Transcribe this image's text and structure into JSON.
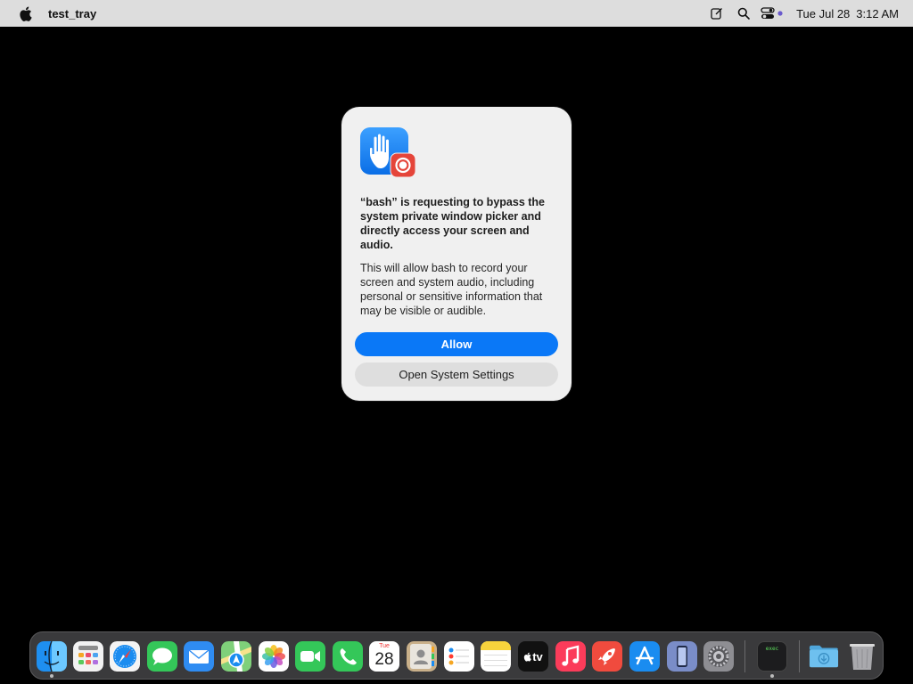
{
  "menubar": {
    "app_name": "test_tray",
    "date": "Tue Jul 28",
    "time": "3:12 AM",
    "icons": [
      "apple-logo-icon",
      "compose-icon",
      "search-icon",
      "control-center-icon"
    ]
  },
  "dialog": {
    "title": "“bash” is requesting to bypass the system private window picker and directly access your screen and audio.",
    "body": "This will allow bash to record your screen and system audio, including personal or sensitive information that may be visible or audible.",
    "allow_label": "Allow",
    "settings_label": "Open System Settings"
  },
  "dock": {
    "calendar_month": "Tue",
    "calendar_day": "28",
    "tv_label": "tv",
    "exec_label": "exec",
    "items": [
      "finder",
      "launchpad",
      "safari",
      "messages",
      "mail",
      "maps",
      "photos",
      "facetime",
      "phone",
      "calendar",
      "contacts",
      "reminders",
      "notes",
      "tv",
      "music",
      "rocket",
      "app-store",
      "iphone-mirroring",
      "system-settings",
      "exec",
      "downloads",
      "trash"
    ]
  },
  "colors": {
    "accent": "#0a78f7",
    "desktop": "#000000",
    "dialog_bg": "#f0f0f0"
  }
}
